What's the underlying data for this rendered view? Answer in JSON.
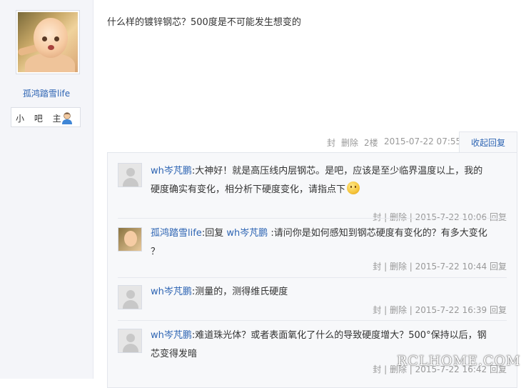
{
  "author": {
    "name": "孤鸿踏雪life",
    "badge_label": "小 吧 主",
    "avatar_icon": "baby-avatar-image",
    "badge_icon": "user-icon"
  },
  "post": {
    "text": "什么样的镀锌钢芯？500度是不可能发生想变的",
    "meta": {
      "action_block": "封",
      "action_delete": "删除",
      "floor": "2楼",
      "time": "2015-07-22 07:55"
    },
    "collapse_label": "收起回复"
  },
  "replies": [
    {
      "user": "wh岑芃鹏",
      "text_line1": ":大神好！就是高压线内层钢芯。是吧，应该是至少临界温度以上，我的",
      "text_line2": "硬度确实有变化，相分析下硬度变化，请指点下",
      "emoji": "smile-icon",
      "meta": "封 | 删除 | 2015-7-22 10:06",
      "reply_label": "回复"
    },
    {
      "user": "孤鸿踏雪life",
      "reply_word": ":回复 ",
      "target": "wh岑芃鹏",
      "text_line1": " :请问你是如何感知到钢芯硬度有变化的？有多大变化",
      "text_line2": "？",
      "meta": "封 | 删除 | 2015-7-22 10:44",
      "reply_label": "回复"
    },
    {
      "user": "wh岑芃鹏",
      "text_line1": ":测量的，测得维氏硬度",
      "meta": "封 | 删除 | 2015-7-22 16:39",
      "reply_label": "回复"
    },
    {
      "user": "wh岑芃鹏",
      "text_line1": ":难道珠光体？或者表面氧化了什么的导致硬度增大？500°保持以后，钢",
      "text_line2": "芯变得发暗",
      "meta": "封 | 删除 | 2015-7-22 16:42",
      "reply_label": "回复"
    }
  ],
  "watermark": "RCLHOME.COM",
  "colors": {
    "link": "#2d64b3",
    "meta": "#999999",
    "panel_bg": "#f7f8fa"
  }
}
